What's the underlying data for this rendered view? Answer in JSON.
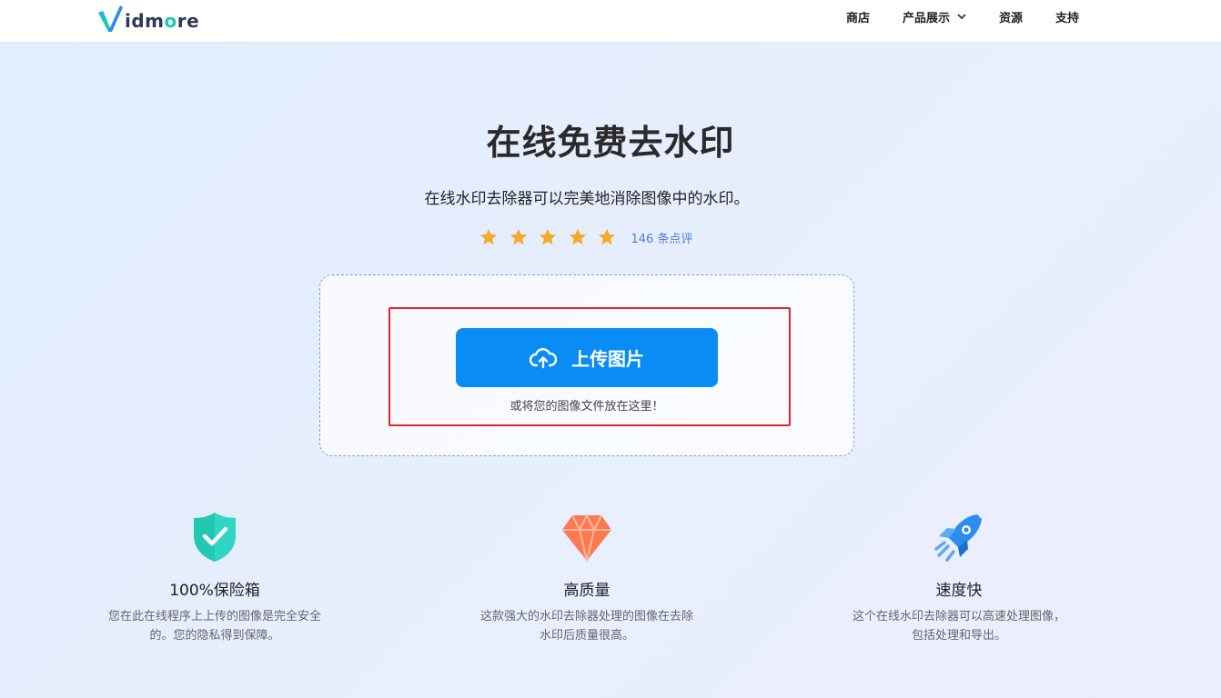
{
  "header": {
    "logo_text_prefix": "idm",
    "logo_text_o": "o",
    "logo_text_suffix": "re",
    "nav": {
      "store": "商店",
      "products": "产品展示",
      "resources": "资源",
      "support": "支持"
    }
  },
  "hero": {
    "title": "在线免费去水印",
    "subtitle": "在线水印去除器可以完美地消除图像中的水印。",
    "rating_stars": 5,
    "reviews": "146 条点评"
  },
  "upload": {
    "button_label": "上传图片",
    "hint": "或将您的图像文件放在这里！"
  },
  "features": [
    {
      "icon": "shield-check-icon",
      "title": "100%保险箱",
      "line1": "您在此在线程序上上传的图像是完全安全",
      "line2": "的。您的隐私得到保障。"
    },
    {
      "icon": "diamond-icon",
      "title": "高质量",
      "line1": "这款强大的水印去除器处理的图像在去除",
      "line2": "水印后质量很高。"
    },
    {
      "icon": "rocket-icon",
      "title": "速度快",
      "line1": "这个在线水印去除器可以高速处理图像，",
      "line2": "包括处理和导出。"
    }
  ],
  "colors": {
    "accent": "#0a8cf5",
    "star": "#f7a928",
    "highlight_border": "#e8222a",
    "link": "#4a7fd8"
  }
}
